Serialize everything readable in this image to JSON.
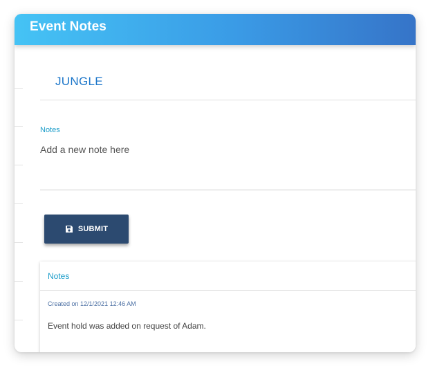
{
  "header": {
    "title": "Event Notes"
  },
  "event": {
    "name": "JUNGLE"
  },
  "form": {
    "notes_label": "Notes",
    "notes_placeholder": "Add a new note here",
    "notes_value": "",
    "submit_label": "SUBMIT",
    "submit_icon": "save-icon"
  },
  "notes_panel": {
    "title": "Notes",
    "items": [
      {
        "created": "Created on 12/1/2021 12:46 AM",
        "text": "Event hold was added on request of Adam."
      }
    ]
  },
  "colors": {
    "header_gradient_start": "#45c3f5",
    "header_gradient_end": "#3674c8",
    "accent_blue": "#1a75c9",
    "label_cyan": "#1a9cc9",
    "button_navy": "#2c4a70"
  }
}
